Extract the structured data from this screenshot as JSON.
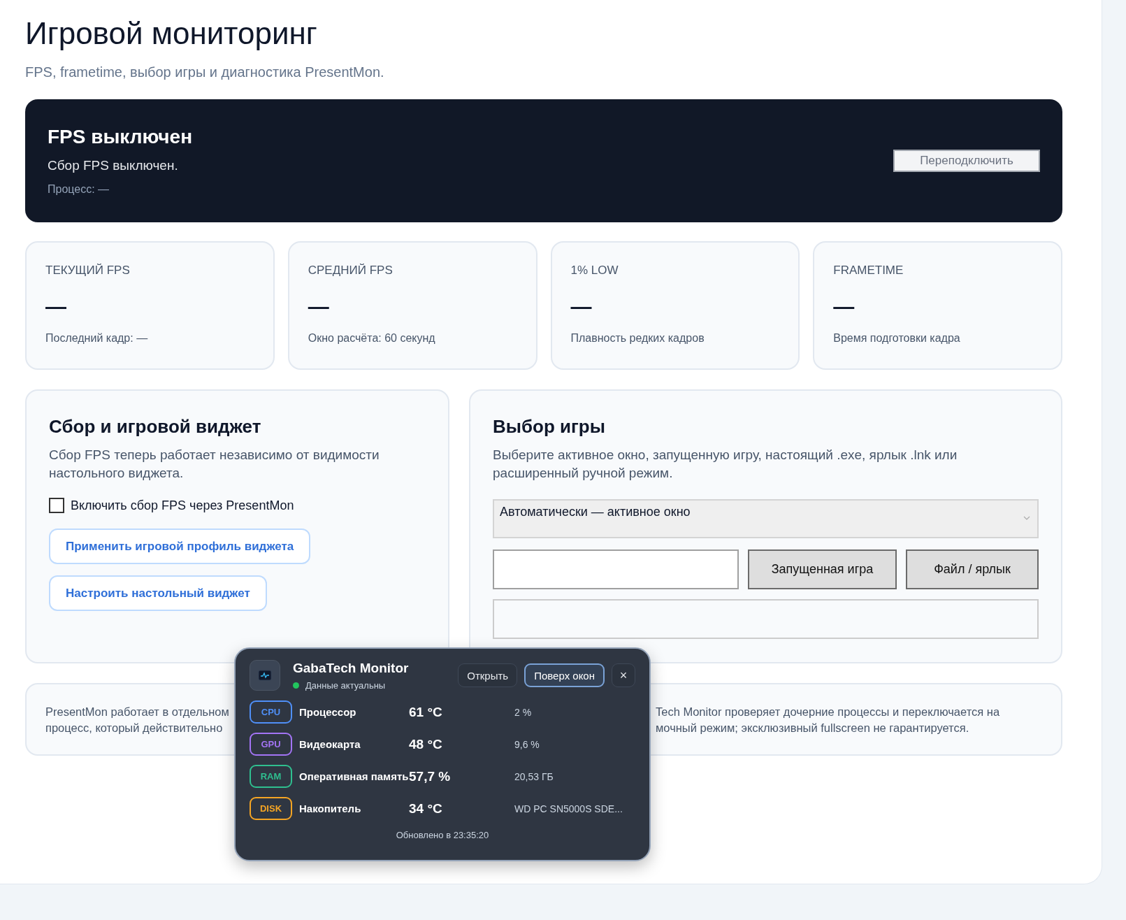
{
  "page": {
    "title": "Игровой мониторинг",
    "subtitle": "FPS, frametime, выбор игры и диагностика PresentMon."
  },
  "banner": {
    "title": "FPS выключен",
    "message": "Сбор FPS выключен.",
    "process": "Процесс: —",
    "reconnect_button": "Переподключить"
  },
  "stats": [
    {
      "label": "ТЕКУЩИЙ FPS",
      "value": "—",
      "note": "Последний кадр: —"
    },
    {
      "label": "СРЕДНИЙ FPS",
      "value": "—",
      "note": "Окно расчёта: 60 секунд"
    },
    {
      "label": "1% LOW",
      "value": "—",
      "note": "Плавность редких кадров"
    },
    {
      "label": "FRAMETIME",
      "value": "—",
      "note": "Время подготовки кадра"
    }
  ],
  "collection_panel": {
    "title": "Сбор и игровой виджет",
    "description": "Сбор FPS теперь работает независимо от видимости настольного виджета.",
    "checkbox": {
      "label": "Включить сбор FPS через PresentMon",
      "checked": false
    },
    "buttons": [
      "Применить игровой профиль виджета",
      "Настроить настольный виджет"
    ]
  },
  "game_panel": {
    "title": "Выбор игры",
    "description": "Выберите активное окно, запущенную игру, настоящий .exe, ярлык .lnk или расширенный ручной режим.",
    "select": {
      "value": "Автоматически — активное окно"
    },
    "buttons": [
      "Запущенная игра",
      "Файл / ярлык"
    ]
  },
  "info_lines": [
    {
      "left": "PresentMon работает в отдельном",
      "right": "Tech Monitor проверяет дочерние процессы и переключается на"
    },
    {
      "left": "процесс, который действительно",
      "right": "мочный режим; эксклюзивный fullscreen не гарантируется."
    }
  ],
  "widget": {
    "title": "GabaTech Monitor",
    "status": "Данные актуальны",
    "status_ok": true,
    "buttons": [
      {
        "label": "Открыть",
        "selected": false
      },
      {
        "label": "Поверх окон",
        "selected": true
      }
    ],
    "close": "×",
    "rows": [
      {
        "tag": "CPU",
        "color": "#4f8ff7",
        "name": "Процессор",
        "value": "61 °C",
        "detail": "2 %"
      },
      {
        "tag": "GPU",
        "color": "#a374f5",
        "name": "Видеокарта",
        "value": "48 °C",
        "detail": "9,6 %"
      },
      {
        "tag": "RAM",
        "color": "#2fbf8f",
        "name": "Оперативная память",
        "value": "57,7 %",
        "detail": "20,53 ГБ"
      },
      {
        "tag": "DISK",
        "color": "#f5a524",
        "name": "Накопитель",
        "value": "34 °C",
        "detail": "WD PC SN5000S SDE..."
      }
    ],
    "updated": "Обновлено в 23:35:20"
  }
}
